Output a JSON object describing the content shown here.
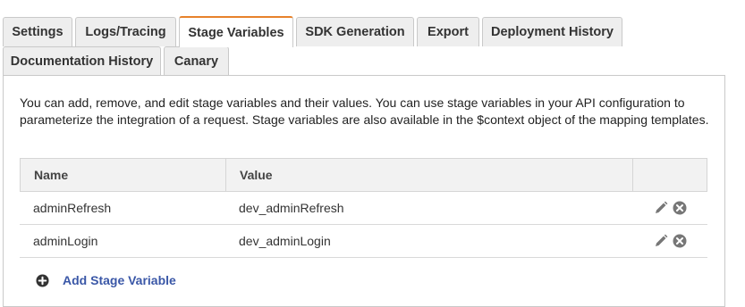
{
  "tabs": [
    {
      "label": "Settings",
      "active": false
    },
    {
      "label": "Logs/Tracing",
      "active": false
    },
    {
      "label": "Stage Variables",
      "active": true
    },
    {
      "label": "SDK Generation",
      "active": false
    },
    {
      "label": "Export",
      "active": false
    },
    {
      "label": "Deployment History",
      "active": false
    },
    {
      "label": "Documentation History",
      "active": false
    },
    {
      "label": "Canary",
      "active": false
    }
  ],
  "description": "You can add, remove, and edit stage variables and their values. You can use stage variables in your API configuration to parameterize the integration of a request. Stage variables are also available in the $context object of the mapping templates.",
  "table": {
    "headers": {
      "name": "Name",
      "value": "Value"
    },
    "rows": [
      {
        "name": "adminRefresh",
        "value": "dev_adminRefresh"
      },
      {
        "name": "adminLogin",
        "value": "dev_adminLogin"
      }
    ]
  },
  "add_button": {
    "label": "Add Stage Variable",
    "icon": "plus-circle-icon"
  },
  "colors": {
    "active_tab_accent": "#e7822b",
    "link": "#3a57a7",
    "icon_gray": "#666666"
  }
}
